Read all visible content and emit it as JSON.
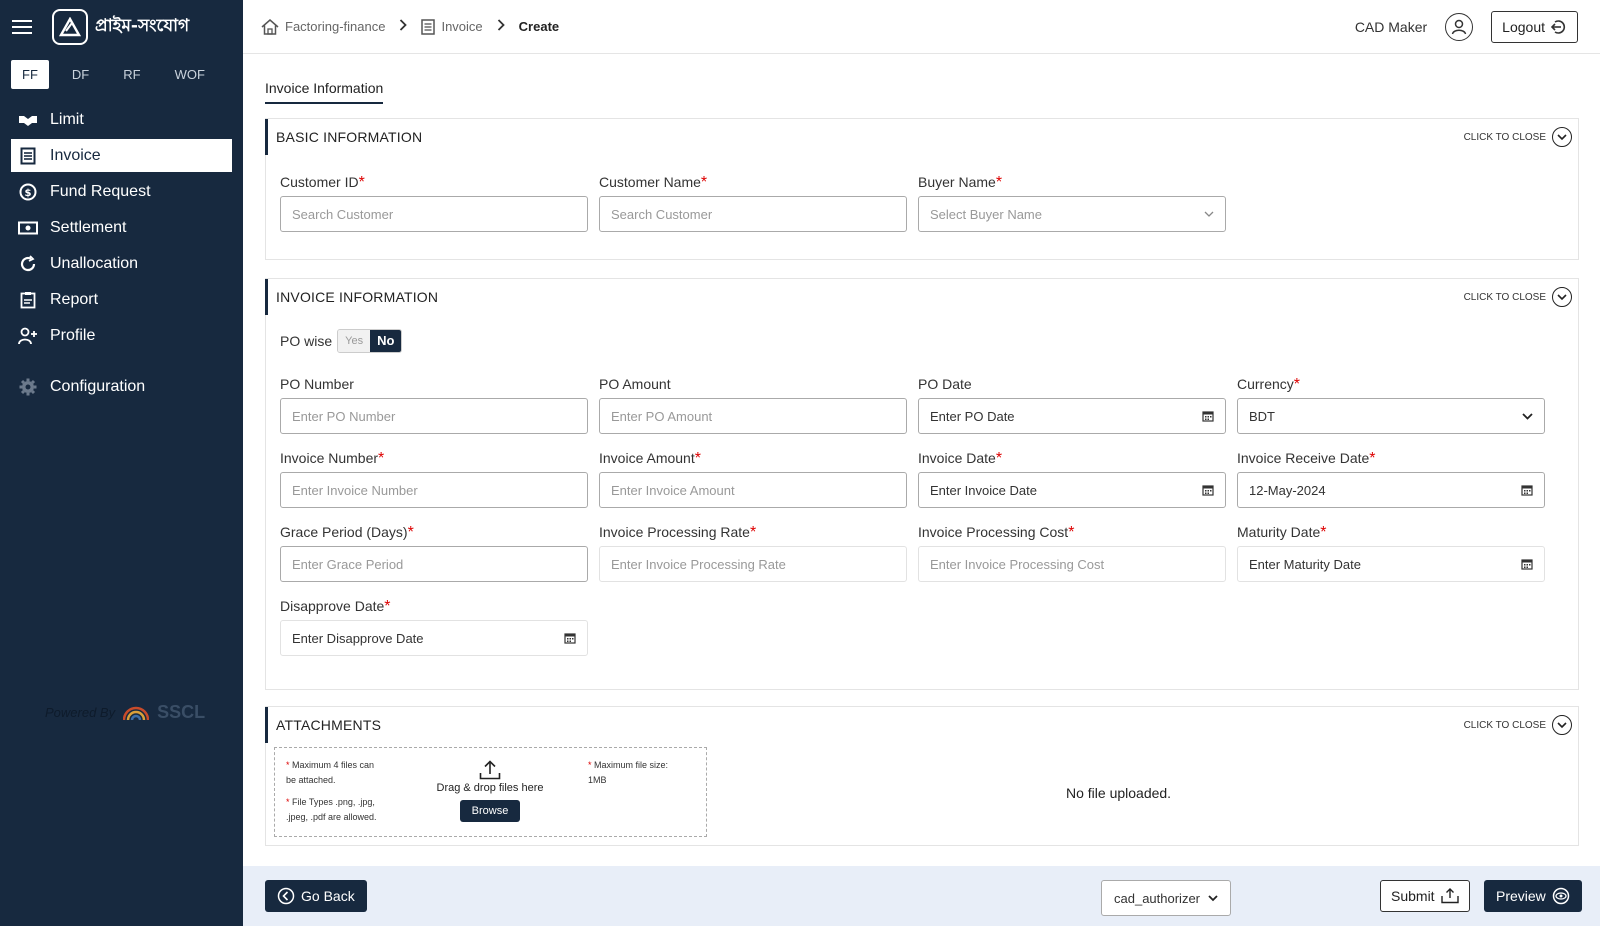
{
  "app": {
    "logo_text": "প্রাইম-সংযোগ"
  },
  "sidebar": {
    "tabs": [
      {
        "label": "FF",
        "active": true
      },
      {
        "label": "DF"
      },
      {
        "label": "RF"
      },
      {
        "label": "WOF"
      }
    ],
    "items": [
      {
        "label": "Limit",
        "icon": "handshake-icon"
      },
      {
        "label": "Invoice",
        "icon": "invoice-icon",
        "active": true
      },
      {
        "label": "Fund Request",
        "icon": "dollar-circle-icon"
      },
      {
        "label": "Settlement",
        "icon": "cash-icon"
      },
      {
        "label": "Unallocation",
        "icon": "refresh-icon"
      },
      {
        "label": "Report",
        "icon": "clipboard-icon"
      },
      {
        "label": "Profile",
        "icon": "user-plus-icon"
      },
      {
        "label": "Configuration",
        "icon": "gear-icon"
      }
    ],
    "powered_by": "Powered By",
    "powered_brand": "SSCL"
  },
  "header": {
    "breadcrumbs": [
      "Factoring-finance",
      "Invoice",
      "Create"
    ],
    "user_role": "CAD Maker",
    "logout_label": "Logout"
  },
  "page": {
    "tab_label": "Invoice Information",
    "close_label": "CLICK TO CLOSE"
  },
  "basic": {
    "title": "BASIC INFORMATION",
    "customer_id": {
      "label": "Customer ID",
      "placeholder": "Search Customer"
    },
    "customer_name": {
      "label": "Customer Name",
      "placeholder": "Search Customer"
    },
    "buyer_name": {
      "label": "Buyer Name",
      "placeholder": "Select Buyer Name"
    }
  },
  "invoice": {
    "title": "INVOICE INFORMATION",
    "po_wise": {
      "label": "PO wise",
      "yes": "Yes",
      "no": "No",
      "selected": "No"
    },
    "po_number": {
      "label": "PO Number",
      "placeholder": "Enter PO Number"
    },
    "po_amount": {
      "label": "PO Amount",
      "placeholder": "Enter PO Amount"
    },
    "po_date": {
      "label": "PO Date",
      "placeholder": "Enter PO Date"
    },
    "currency": {
      "label": "Currency",
      "value": "BDT"
    },
    "invoice_number": {
      "label": "Invoice Number",
      "placeholder": "Enter Invoice Number"
    },
    "invoice_amount": {
      "label": "Invoice Amount",
      "placeholder": "Enter Invoice Amount"
    },
    "invoice_date": {
      "label": "Invoice Date",
      "placeholder": "Enter Invoice Date"
    },
    "invoice_receive_date": {
      "label": "Invoice Receive Date",
      "value": "12-May-2024"
    },
    "grace_period": {
      "label": "Grace Period (Days)",
      "placeholder": "Enter Grace Period"
    },
    "processing_rate": {
      "label": "Invoice Processing Rate",
      "placeholder": "Enter Invoice Processing Rate"
    },
    "processing_cost": {
      "label": "Invoice Processing Cost",
      "placeholder": "Enter Invoice Processing Cost"
    },
    "maturity_date": {
      "label": "Maturity Date",
      "placeholder": "Enter Maturity Date"
    },
    "disapprove_date": {
      "label": "Disapprove Date",
      "placeholder": "Enter Disapprove Date"
    }
  },
  "attachments": {
    "title": "ATTACHMENTS",
    "note_max_files_1": "Maximum 4 files can",
    "note_max_files_2": "be attached.",
    "note_types_1": "File Types .png, .jpg,",
    "note_types_2": ".jpeg, .pdf are allowed.",
    "note_size_1": "Maximum file size:",
    "note_size_2": "1MB",
    "drag_text": "Drag & drop files here",
    "browse_label": "Browse",
    "empty_text": "No file uploaded."
  },
  "footer": {
    "go_back_label": "Go Back",
    "authorizer_value": "cad_authorizer",
    "submit_label": "Submit",
    "preview_label": "Preview"
  }
}
